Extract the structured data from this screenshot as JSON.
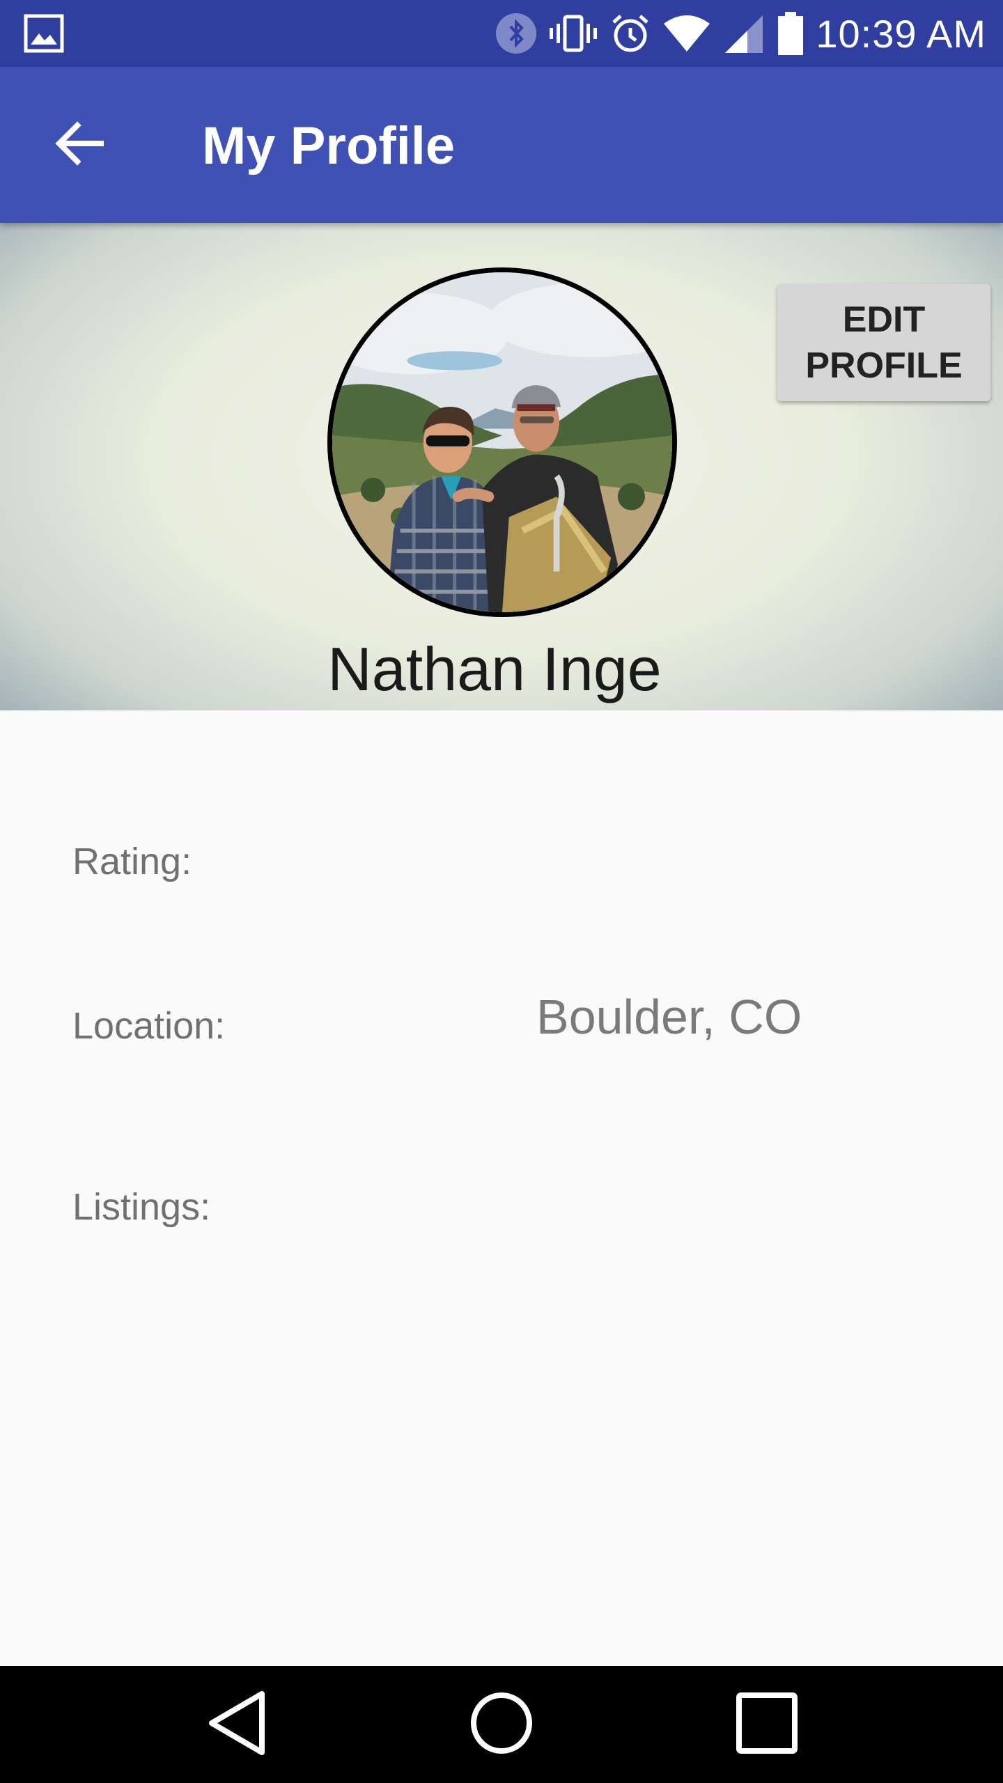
{
  "status_bar": {
    "time": "10:39 AM",
    "icons": [
      "image-icon",
      "bluetooth-icon",
      "vibrate-icon",
      "alarm-icon",
      "wifi-icon",
      "signal-icon",
      "battery-icon"
    ]
  },
  "app_bar": {
    "title": "My Profile",
    "back_icon": "arrow-back-icon"
  },
  "profile": {
    "name": "Nathan Inge",
    "edit_button_label": "EDIT\nPROFILE",
    "avatar": "profile-photo"
  },
  "details": {
    "rating_label": "Rating:",
    "location_label": "Location:",
    "location_value": "Boulder, CO",
    "listings_label": "Listings:"
  },
  "nav_bar": {
    "icons": [
      "back-triangle-icon",
      "home-circle-icon",
      "recents-square-icon"
    ]
  },
  "colors": {
    "status_bar": "#303f9f",
    "app_bar": "#3f51b5",
    "background": "#fafafa",
    "nav_bar": "#000000"
  }
}
